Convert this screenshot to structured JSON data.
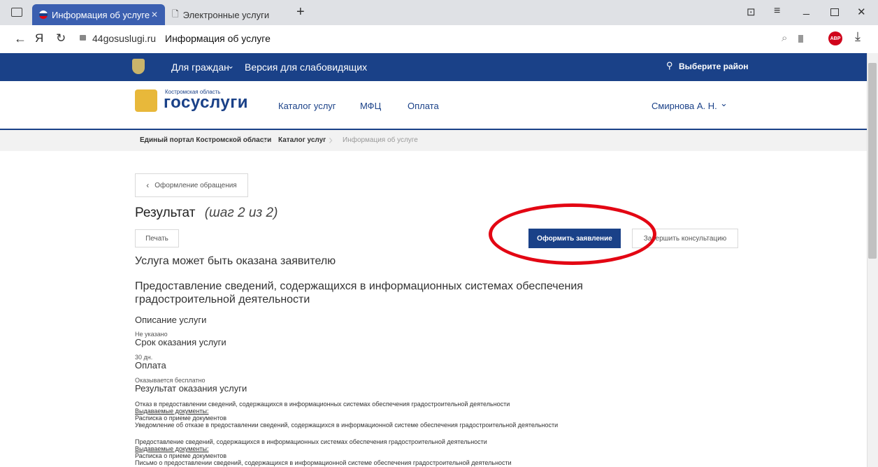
{
  "browser": {
    "tabs": [
      "Информация об услуге",
      "Электронные услуги"
    ],
    "new_tab": "+",
    "url_host": "44gosuslugi.ru",
    "url_title": "Информация об услуге"
  },
  "topnav": {
    "citizens": "Для граждан",
    "low_vision": "Версия для слабовидящих",
    "region": "Выберите район"
  },
  "header": {
    "logo_small": "Костромская область",
    "logo_big": "госуслуги",
    "nav": [
      "Каталог услуг",
      "МФЦ",
      "Оплата"
    ],
    "user": "Смирнова А. Н."
  },
  "breadcrumbs": [
    "Единый портал Костромской области",
    "Каталог услуг",
    "Информация об услуге"
  ],
  "page": {
    "back_label": "Оформление обращения",
    "title": "Результат",
    "step": "(шаг 2 из 2)",
    "print": "Печать",
    "apply": "Оформить заявление",
    "finish": "Завершить консультацию",
    "can_provide": "Услуга может быть оказана заявителю",
    "service_name": "Предоставление сведений, содержащихся в информационных системах обеспечения градостроительной деятельности",
    "desc_h": "Описание услуги",
    "desc_v": "Не указано",
    "term_h": "Срок оказания услуги",
    "term_v": "30 дн.",
    "pay_h": "Оплата",
    "pay_v": "Оказывается бесплатно",
    "result_h": "Результат оказания услуги",
    "result1": "Отказ в предоставлении сведений, содержащихся в информационных системах обеспечения градостроительной деятельности",
    "issued": "Выдаваемые документы:",
    "doc1": "Расписка о приеме документов",
    "doc2": "Уведомление об отказе в предоставлении сведений, содержащихся в информационной системе обеспечения градостроительной деятельности",
    "result2": "Предоставление сведений, содержащихся в информационных системах обеспечения градостроительной деятельности",
    "doc3": "Расписка о приеме документов",
    "doc4": "Письмо о предоставлении сведений, содержащихся в информационной системе обеспечения градостроительной деятельности"
  },
  "colors": {
    "brand": "#1a4188",
    "highlight": "#e30613"
  }
}
